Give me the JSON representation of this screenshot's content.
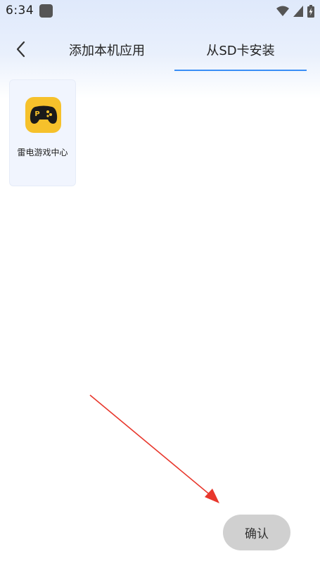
{
  "status_bar": {
    "time": "6:34",
    "icons": [
      "app-notification-icon",
      "wifi-icon",
      "cellular-signal-icon",
      "battery-charging-icon"
    ]
  },
  "header": {
    "back_icon": "chevron-left-icon",
    "tabs": [
      {
        "label": "添加本机应用",
        "active": false
      },
      {
        "label": "从SD卡安装",
        "active": true
      }
    ],
    "accent_color": "#3a8ef6"
  },
  "apps": [
    {
      "name": "雷电游戏中心",
      "icon": "gamepad-icon",
      "icon_bg": "#f6c12b"
    }
  ],
  "annotation": {
    "type": "red-arrow",
    "color": "#e8372c",
    "points_to": "confirm-button"
  },
  "footer": {
    "confirm_label": "确认"
  }
}
